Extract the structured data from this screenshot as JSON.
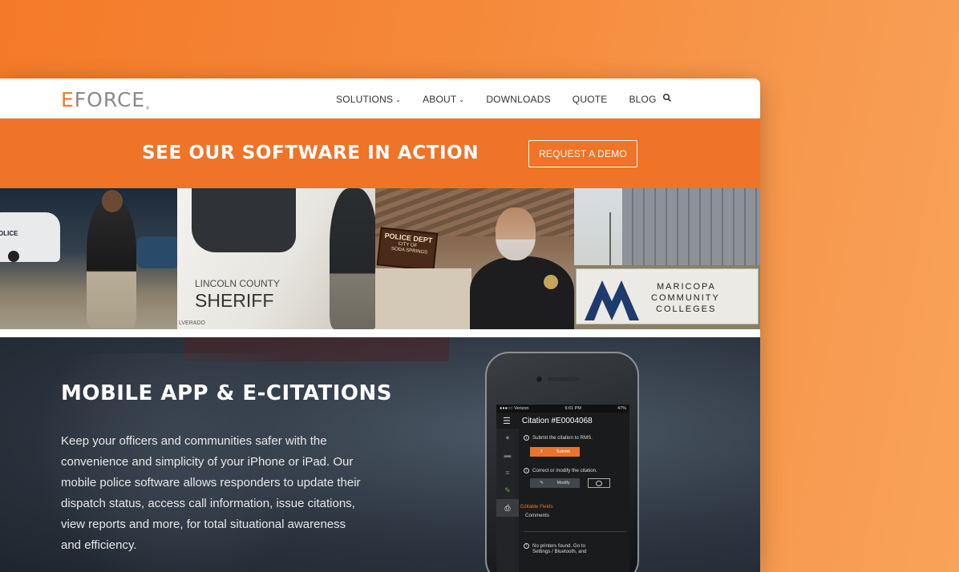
{
  "header": {
    "logo": {
      "e": "E",
      "rest": "FORCE",
      "reg": "®"
    },
    "nav": [
      {
        "label": "SOLUTIONS",
        "dropdown": true
      },
      {
        "label": "ABOUT",
        "dropdown": true
      },
      {
        "label": "DOWNLOADS",
        "dropdown": false
      },
      {
        "label": "QUOTE",
        "dropdown": false
      },
      {
        "label": "BLOG",
        "dropdown": false
      }
    ],
    "search_icon": "search-icon"
  },
  "banner": {
    "title": "SEE OUR SOFTWARE IN ACTION",
    "cta": "REQUEST A DEMO"
  },
  "photos": {
    "p1": {
      "car_text": "OLICE"
    },
    "p2": {
      "line1": "LINCOLN COUNTY",
      "line2": "SHERIFF",
      "plate": "LVERADO"
    },
    "p3": {
      "sign1": "POLICE DEPT",
      "sign2": "CITY OF",
      "sign3": "SODA SPRINGS"
    },
    "p4": {
      "line1": "MARICOPA",
      "line2": "COMMUNITY",
      "line3": "COLLEGES"
    }
  },
  "mobile": {
    "title": "MOBILE APP & E-CITATIONS",
    "text": "Keep your officers and communities safer with the convenience and simplicity of your iPhone or iPad. Our mobile police software allows responders to update their dispatch status, access call information, issue citations, view reports and more, for total situational awareness and efficiency."
  },
  "phone": {
    "carrier": "●●●○○ Verizon",
    "time": "6:01 PM",
    "battery": "47%",
    "title": "Citation #E0004068",
    "submit_hint": "Submit the citation to RMS.",
    "submit_label": "Submit",
    "modify_hint": "Correct or modify the citation.",
    "modify_label": "Modify",
    "editable_fields": "Editable Fields",
    "comments": "Comments",
    "no_printers": "No printers found. Go to Settings / Bluetooth, and"
  },
  "colors": {
    "accent": "#ef7427",
    "dark": "#2c3540"
  }
}
